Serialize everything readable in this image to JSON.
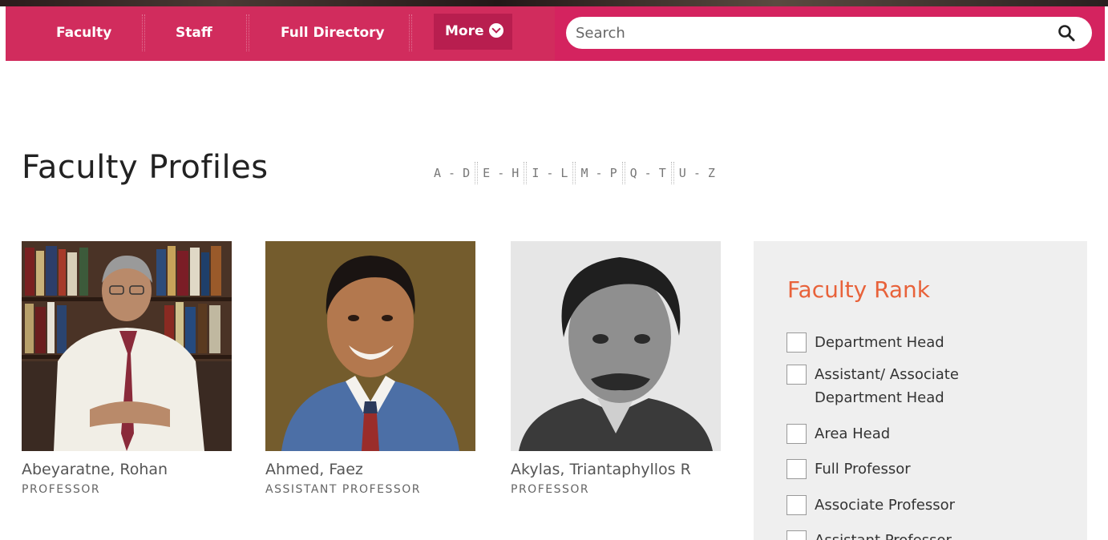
{
  "nav": {
    "links": [
      "Faculty",
      "Staff",
      "Full Directory"
    ],
    "more_label": "More",
    "search_placeholder": "Search"
  },
  "page": {
    "title": "Faculty Profiles",
    "alpha_ranges": [
      "A - D",
      "E - H",
      "I - L",
      "M - P",
      "Q - T",
      "U - Z"
    ]
  },
  "profiles": [
    {
      "name": "Abeyaratne, Rohan",
      "rank": "PROFESSOR"
    },
    {
      "name": "Ahmed, Faez",
      "rank": "ASSISTANT PROFESSOR"
    },
    {
      "name": "Akylas, Triantaphyllos R",
      "rank": "PROFESSOR"
    }
  ],
  "filter": {
    "title": "Faculty Rank",
    "options": [
      "Department Head",
      "Assistant/ Associate",
      "Department Head",
      "Area Head",
      "Full Professor",
      "Associate Professor",
      "Assistant Professor"
    ]
  },
  "colors": {
    "nav_bg": "#d4235f",
    "more_bg": "#b81e4f",
    "filter_title": "#e8623a",
    "panel_bg": "#efefef"
  }
}
